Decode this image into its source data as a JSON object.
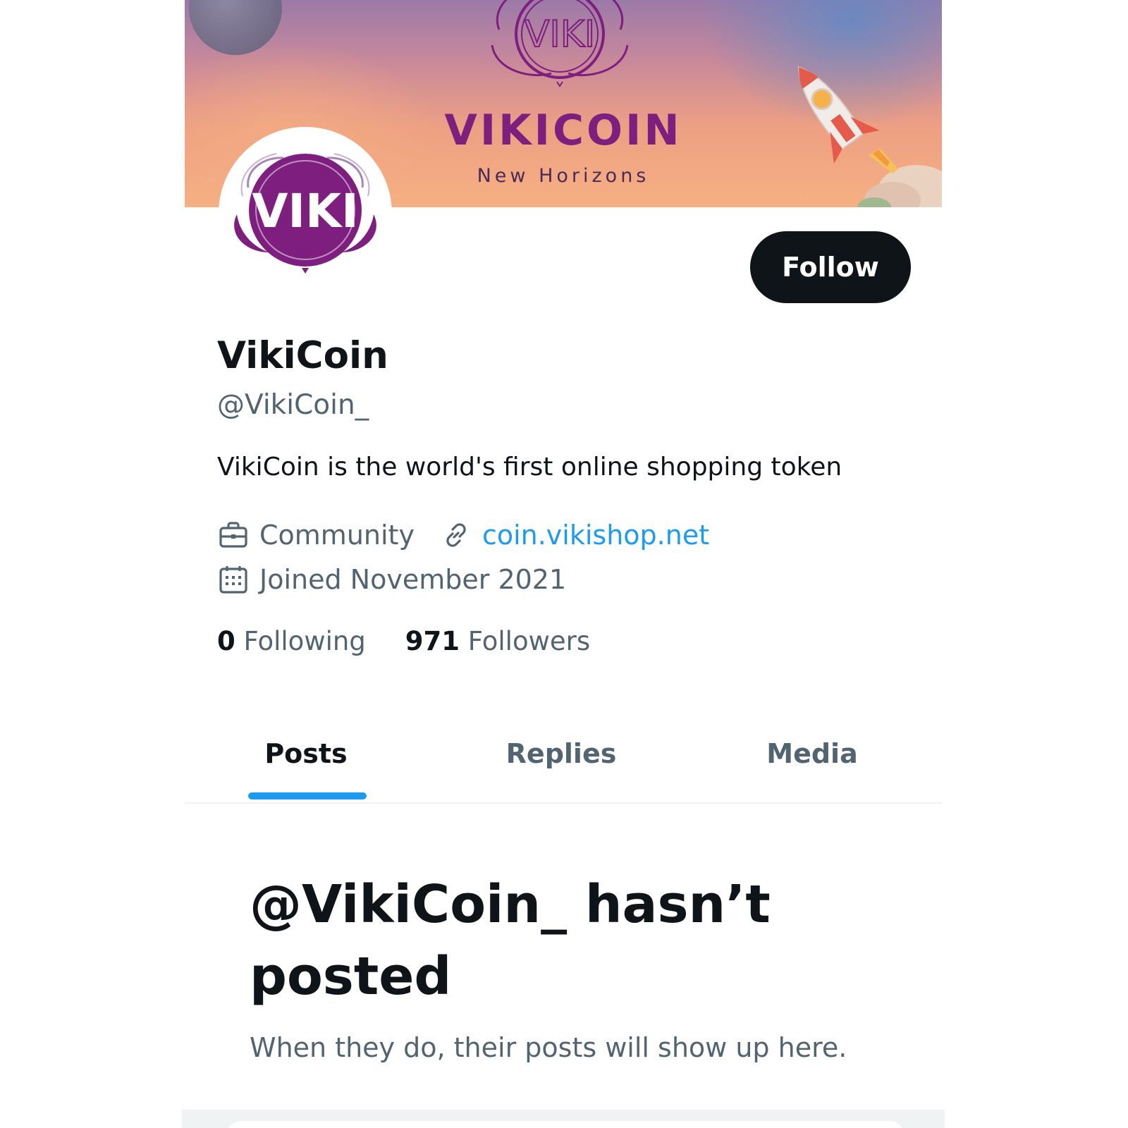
{
  "banner": {
    "emblem_text": "VIKI",
    "title": "VIKICOIN",
    "subtitle": "New Horizons",
    "colors": {
      "brand_purple": "#7e1f80"
    }
  },
  "avatar": {
    "text": "VIKI",
    "icon": "vikicoin-logo"
  },
  "profile": {
    "follow_label": "Follow",
    "display_name": "VikiCoin",
    "handle": "@VikiCoin_",
    "bio": "VikiCoin is the world's first online shopping token",
    "category": {
      "icon": "briefcase-icon",
      "label": "Community"
    },
    "website": {
      "icon": "link-icon",
      "label": "coin.vikishop.net"
    },
    "joined": {
      "icon": "calendar-icon",
      "label": "Joined November 2021"
    }
  },
  "counts": {
    "following": {
      "value": "0",
      "label": "Following"
    },
    "followers": {
      "value": "971",
      "label": "Followers"
    }
  },
  "tabs": [
    {
      "label": "Posts",
      "active": true
    },
    {
      "label": "Replies",
      "active": false
    },
    {
      "label": "Media",
      "active": false
    }
  ],
  "empty_state": {
    "title": "@VikiCoin_ hasn’t posted",
    "subtitle": "When they do, their posts will show up here."
  },
  "colors": {
    "text_primary": "#0f1419",
    "text_secondary": "#536471",
    "accent": "#1d9bf0",
    "button_bg": "#0f1419"
  }
}
